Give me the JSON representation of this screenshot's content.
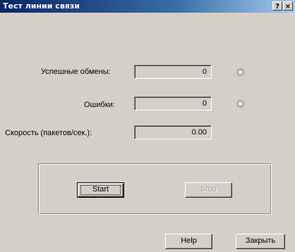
{
  "window": {
    "title": "Тест линии связи",
    "help_glyph": "?",
    "close_glyph": "×"
  },
  "stats": {
    "success_label": "Успешные обмены:",
    "success_value": "0",
    "errors_label": "Ошибки:",
    "errors_value": "0",
    "speed_label": "Скорость  (пакетов/сек.):",
    "speed_value": "0.00"
  },
  "controls": {
    "start_label": "Start",
    "stop_label": "Stop"
  },
  "footer": {
    "help_label": "Help",
    "close_label": "Закрыть"
  },
  "colors": {
    "title_gradient_start": "#0a246a",
    "title_gradient_end": "#a6caf0",
    "face": "#d4d0c8"
  }
}
